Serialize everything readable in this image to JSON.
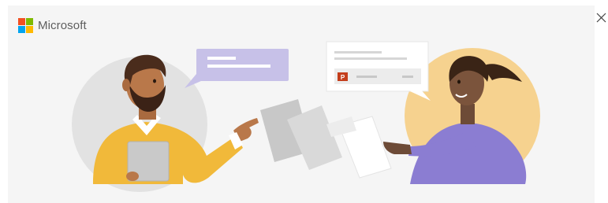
{
  "brand": {
    "name": "Microsoft",
    "logo_colors": [
      "#f25022",
      "#7fba00",
      "#00a4ef",
      "#ffb900"
    ]
  },
  "close_icon": "close-icon",
  "colors": {
    "hero_background": "#f5f5f5",
    "chat_bubble": "#c7c1e8",
    "left_circle": "#e2e2e2",
    "right_circle": "#f6d28f",
    "sweater_yellow": "#f1b93a",
    "sweater_purple": "#8b7dd2"
  }
}
